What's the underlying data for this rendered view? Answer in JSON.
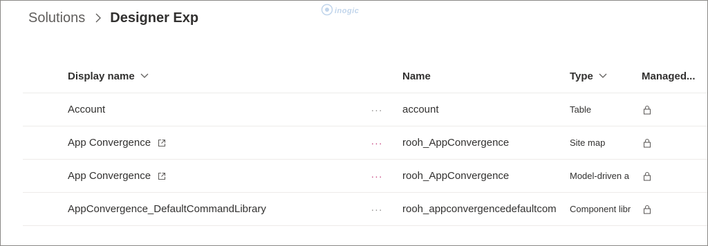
{
  "breadcrumb": {
    "parent": "Solutions",
    "current": "Designer Exp",
    "separator_icon": "chevron-right-icon"
  },
  "watermark": {
    "text": "inogic"
  },
  "table": {
    "columns": {
      "display_name": "Display name",
      "name": "Name",
      "type": "Type",
      "managed": "Managed..."
    },
    "rows": [
      {
        "display_name": "Account",
        "has_external_link": false,
        "more": "···",
        "name": "account",
        "type": "Table",
        "managed_icon": "lock-icon"
      },
      {
        "display_name": "App Convergence",
        "has_external_link": true,
        "more": "···",
        "name": "rooh_AppConvergence",
        "type": "Site map",
        "managed_icon": "lock-icon"
      },
      {
        "display_name": "App Convergence",
        "has_external_link": true,
        "more": "···",
        "name": "rooh_AppConvergence",
        "type": "Model-driven a",
        "managed_icon": "lock-icon"
      },
      {
        "display_name": "AppConvergence_DefaultCommandLibrary",
        "has_external_link": false,
        "more": "···",
        "name": "rooh_appconvergencedefaultcom",
        "type": "Component libr",
        "managed_icon": "lock-icon"
      }
    ]
  },
  "colors": {
    "text": "#323130",
    "muted": "#605e5c",
    "divider": "#edebe9",
    "accent_dots": "#c43e7b"
  }
}
